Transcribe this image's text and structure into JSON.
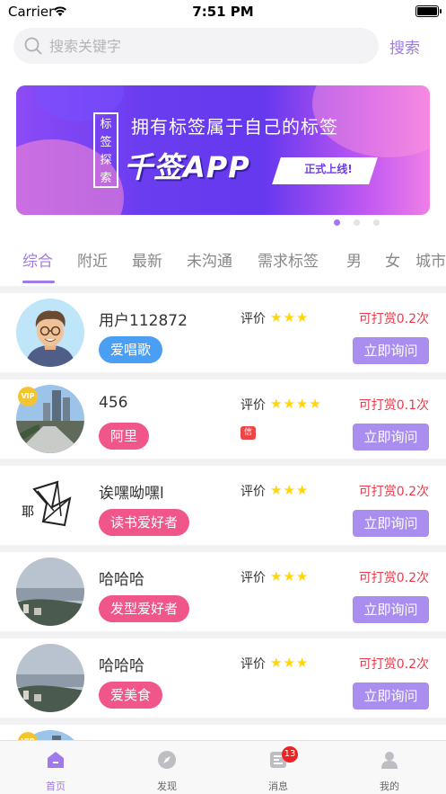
{
  "status_bar": {
    "carrier": "Carrier",
    "time": "7:51 PM"
  },
  "search": {
    "placeholder": "搜索关键字",
    "button_label": "搜索"
  },
  "banner": {
    "tag_text": "标签探索",
    "line1": "拥有标签属于自己的标签",
    "title": "千签APP",
    "ribbon": "正式上线!",
    "page_count": 3,
    "active_page": 1
  },
  "tabs": [
    {
      "label": "综合",
      "active": true
    },
    {
      "label": "附近"
    },
    {
      "label": "最新"
    },
    {
      "label": "未沟通"
    },
    {
      "label": "需求标签"
    },
    {
      "label": "男"
    },
    {
      "label": "女"
    },
    {
      "label": "城市"
    }
  ],
  "list_common": {
    "rating_label": "评价",
    "ask_button": "立即询问",
    "credit_badge": "信"
  },
  "users": [
    {
      "name": "用户112872",
      "tag": "爱唱歌",
      "tag_color": "#4a9ff5",
      "stars": 3,
      "reward": "可打赏0.2次",
      "avatar": "cartoon-man",
      "vip": false,
      "credit": false
    },
    {
      "name": "456",
      "tag": "阿里",
      "tag_color": "#f0568a",
      "stars": 4,
      "reward": "可打赏0.1次",
      "avatar": "city-photo",
      "vip": true,
      "credit": true
    },
    {
      "name": "诶嘿呦嘿l",
      "tag": "读书爱好者",
      "tag_color": "#f0568a",
      "stars": 3,
      "reward": "可打赏0.2次",
      "avatar": "sketch",
      "vip": false,
      "credit": false
    },
    {
      "name": "哈哈哈",
      "tag": "发型爱好者",
      "tag_color": "#f0568a",
      "stars": 3,
      "reward": "可打赏0.2次",
      "avatar": "sea-photo",
      "vip": false,
      "credit": false
    },
    {
      "name": "哈哈哈",
      "tag": "爱美食",
      "tag_color": "#f0568a",
      "stars": 3,
      "reward": "可打赏0.2次",
      "avatar": "sea-photo",
      "vip": false,
      "credit": false
    }
  ],
  "tab_bar": [
    {
      "label": "首页",
      "icon": "home-icon",
      "active": true
    },
    {
      "label": "发现",
      "icon": "compass-icon"
    },
    {
      "label": "消息",
      "icon": "message-icon",
      "badge": "13"
    },
    {
      "label": "我的",
      "icon": "profile-icon"
    }
  ],
  "colors": {
    "accent": "#a07ae8",
    "reward": "#ec3a4a",
    "star": "#ffd60a",
    "ask_button": "#a98ef0"
  }
}
